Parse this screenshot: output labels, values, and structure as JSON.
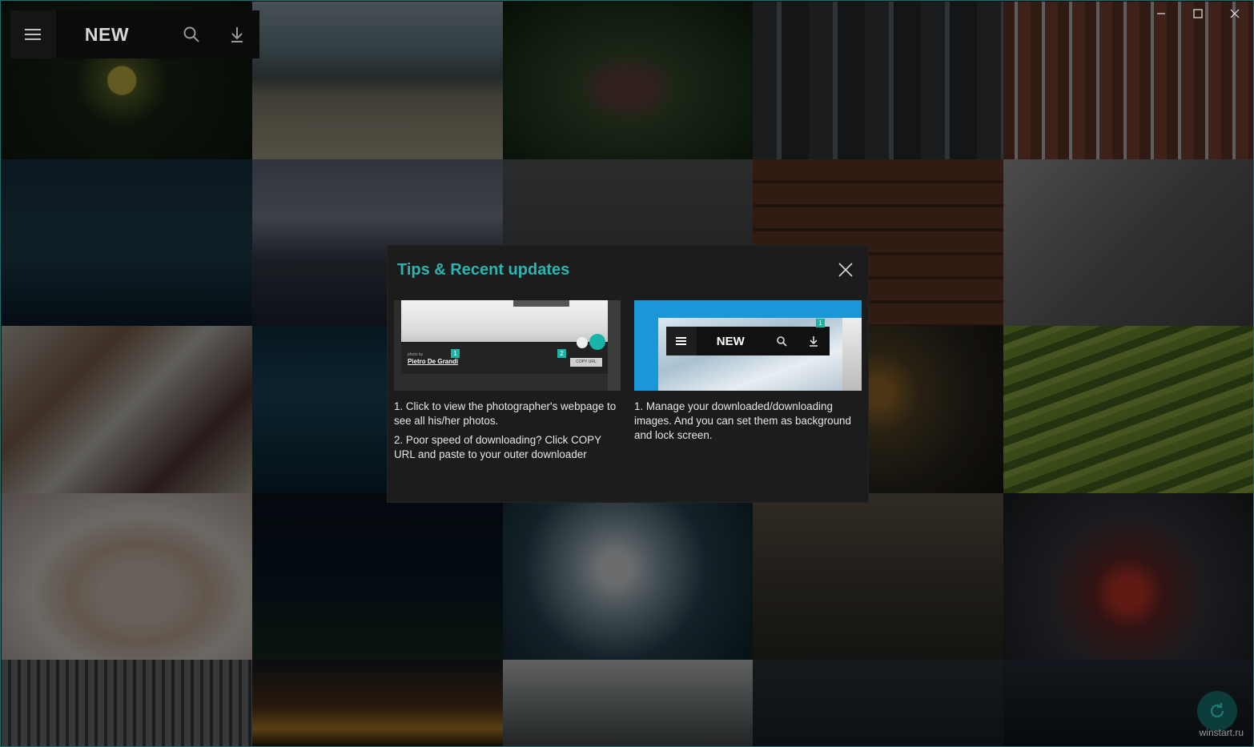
{
  "appbar": {
    "title": "NEW",
    "icons": [
      "menu-icon",
      "search-icon",
      "download-icon"
    ]
  },
  "window_controls": [
    "minimize-icon",
    "maximize-icon",
    "close-icon"
  ],
  "dialog": {
    "title": "Tips & Recent updates",
    "close_icon": "close-icon",
    "left": {
      "thumb": {
        "photo_by": "photo by",
        "photographer": "Pietro De Grandi",
        "badge1": "1",
        "badge2": "2",
        "copy_url": "COPY URL"
      },
      "tips": [
        "1. Click to view the photographer's webpage to see all his/her photos.",
        "2. Poor speed of downloading? Click COPY URL and paste to your outer downloader"
      ]
    },
    "right": {
      "thumb": {
        "title": "NEW",
        "badge": "1"
      },
      "tips": [
        "1. Manage your downloaded/downloading images. And you can set them as background and lock screen."
      ]
    }
  },
  "refresh_icon": "refresh-icon",
  "watermark": "winstart.ru",
  "colors": {
    "accent": "#2cb5b0",
    "dialog_bg": "#1c1c1c",
    "appbar_bg": "#0b0b0b"
  }
}
